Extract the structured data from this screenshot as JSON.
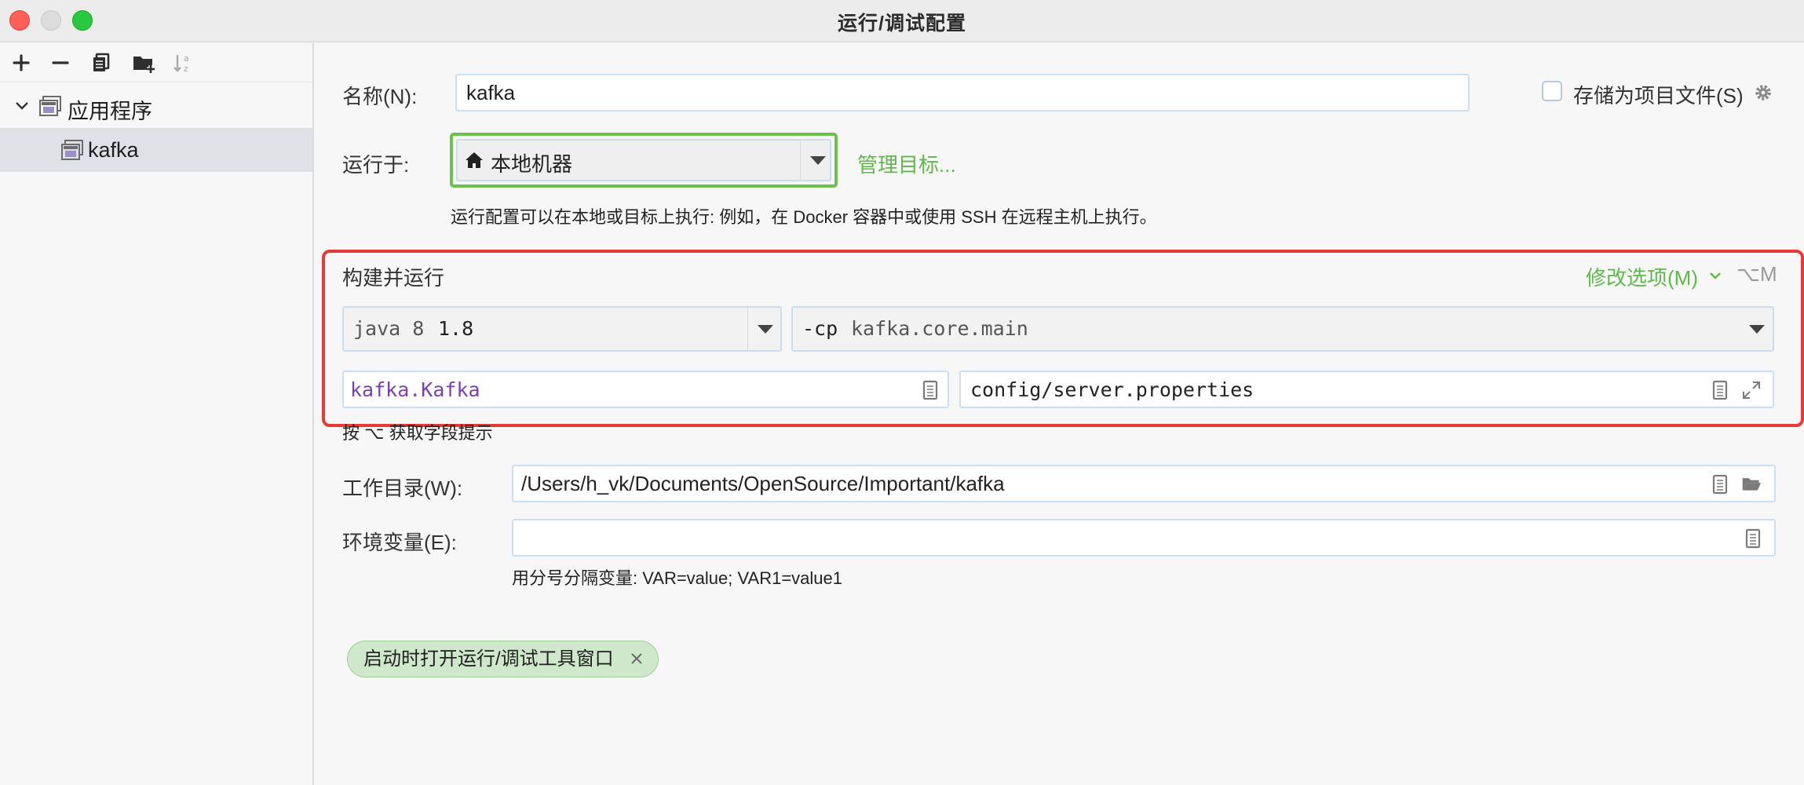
{
  "window": {
    "title": "运行/调试配置"
  },
  "toolbar": {
    "icons": [
      "plus-icon",
      "minus-icon",
      "copy-icon",
      "new-folder-icon",
      "sort-icon"
    ]
  },
  "tree": {
    "group_label": "应用程序",
    "item_label": "kafka"
  },
  "form": {
    "name_label": "名称(N):",
    "name_value": "kafka",
    "store_as_file_label": "存储为项目文件(S)",
    "run_on_label": "运行于:",
    "run_on_value": "本地机器",
    "manage_targets": "管理目标...",
    "run_on_hint": "运行配置可以在本地或目标上执行: 例如，在 Docker 容器中或使用 SSH 在远程主机上执行。",
    "build_run_title": "构建并运行",
    "modify_options": "修改选项(M)",
    "modify_shortcut": "⌥M",
    "jdk_prefix": "java 8",
    "jdk_version": "1.8",
    "cp_prefix": "-cp",
    "cp_value": "kafka.core.main",
    "main_class": "kafka.Kafka",
    "program_args": "config/server.properties",
    "field_hint": "按 ⌥ 获取字段提示",
    "workdir_label": "工作目录(W):",
    "workdir_value": "/Users/h_vk/Documents/OpenSource/Important/kafka",
    "env_label": "环境变量(E):",
    "env_value": "",
    "env_hint": "用分号分隔变量: VAR=value; VAR1=value1",
    "chip_label": "启动时打开运行/调试工具窗口"
  },
  "colors": {
    "highlight_red": "#e43b34",
    "highlight_green": "#6cc24a",
    "link_green": "#5fb84a",
    "main_class_purple": "#7a3fb0"
  }
}
